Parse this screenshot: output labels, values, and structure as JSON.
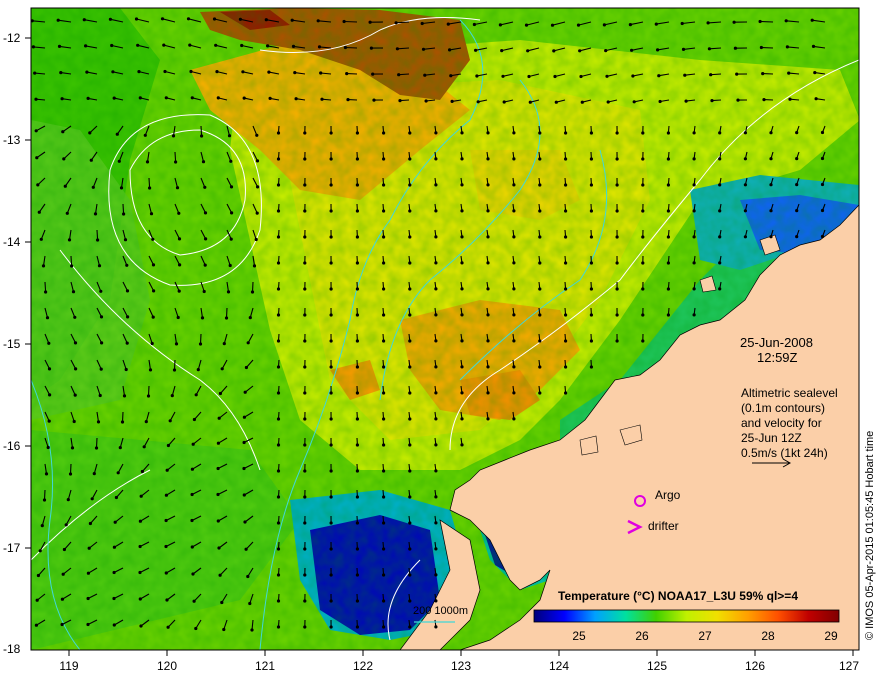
{
  "map": {
    "x_ticks": [
      "119",
      "120",
      "121",
      "122",
      "123",
      "124",
      "125",
      "126",
      "127"
    ],
    "y_ticks": [
      "-12",
      "-13",
      "-14",
      "-15",
      "-16",
      "-17",
      "-18"
    ],
    "land_color": "#fbcfa8",
    "frame_color": "#000000"
  },
  "annotation": {
    "date": "25-Jun-2008",
    "time": "12:59Z",
    "alt_line1": "Altimetric sealevel",
    "alt_line2": "(0.1m contours)",
    "alt_line3": "and velocity for",
    "alt_line4": "25-Jun 12Z",
    "alt_line5": "0.5m/s (1kt 24h)"
  },
  "legend": {
    "argo": "Argo",
    "drifter": "drifter",
    "bathymetry": "200  1000m",
    "marker_color": "#e000e0",
    "contour_color": "#40d8d8"
  },
  "colorbar": {
    "title": "Temperature (°C) NOAA17_L3U 59% ql>=4",
    "ticks": [
      "25",
      "26",
      "27",
      "28",
      "29"
    ],
    "stops": [
      "#00007a",
      "#0000ff",
      "#00a0ff",
      "#00e0a0",
      "#40d000",
      "#c0f000",
      "#f0e000",
      "#ffa000",
      "#ff5000",
      "#c00000",
      "#800000"
    ]
  },
  "credit": "© IMOS 05-Apr-2015 01:05:45 Hobart time"
}
